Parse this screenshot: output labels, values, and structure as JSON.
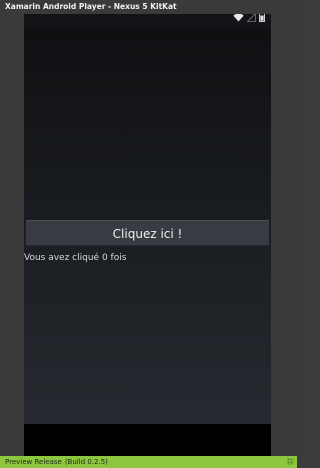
{
  "window": {
    "title": "Xamarin Android Player - Nexus 5 KitKat"
  },
  "status_bar": {
    "icons": [
      "wifi-icon",
      "signal-icon",
      "battery-icon"
    ]
  },
  "app": {
    "button_label": "Cliquez ici !",
    "count_text": "Vous avez cliqué 0 fois"
  },
  "footer": {
    "release_label": "Preview Release",
    "build_label": "(Build 0.2.5)"
  },
  "colors": {
    "accent_footer": "#8dc63f",
    "window_bg": "#3a3a3a",
    "button_bg": "#383c42"
  }
}
